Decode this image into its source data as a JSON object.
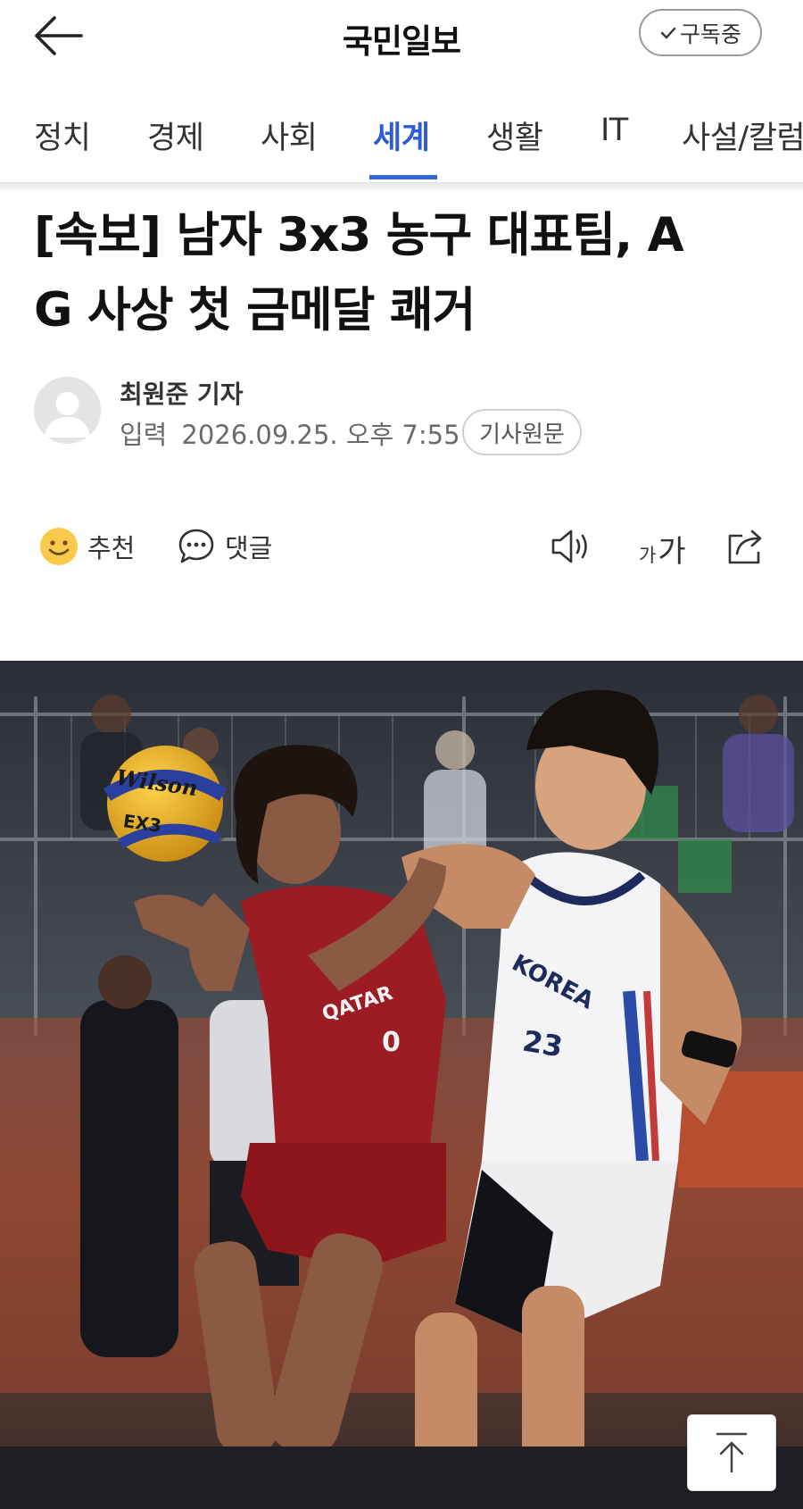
{
  "header": {
    "logo": "국민일보",
    "subscribe_label": "구독중"
  },
  "nav": {
    "items": [
      "정치",
      "경제",
      "사회",
      "세계",
      "생활",
      "IT",
      "사설/칼럼"
    ],
    "active": "세계"
  },
  "article": {
    "headline_line1": "[속보] 남자 3x3 농구 대표팀, A",
    "headline_line2": "G 사상 첫 금메달 쾌거",
    "author": "최원준 기자",
    "date_label": "입력",
    "date": "2026.09.25. 오후 7:55",
    "source_button": "기사원문"
  },
  "actions": {
    "recommend": "추천",
    "comment": "댓글",
    "font_size_small": "가",
    "font_size_large": "가"
  },
  "photo": {
    "ball_text": "Wilson",
    "ball_logo": "EX3",
    "jersey_left_team": "QATAR",
    "jersey_left_number": "0",
    "jersey_right_team": "KOREA",
    "jersey_right_number": "23"
  },
  "colors": {
    "accent": "#2d5bd7",
    "qatar_red": "#9b1c22",
    "korea_white": "#f4f4f6"
  }
}
